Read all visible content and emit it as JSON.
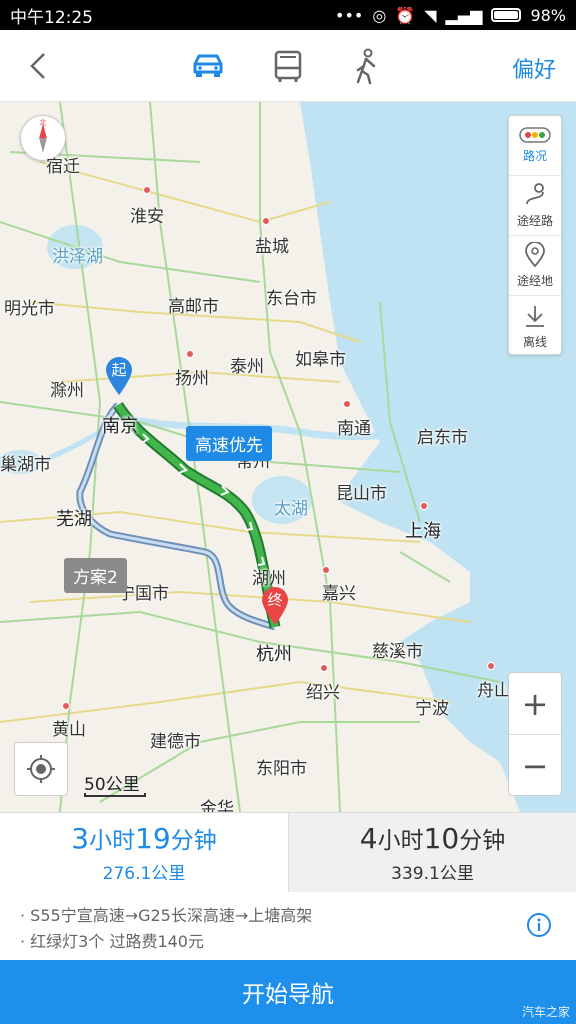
{
  "status_bar": {
    "time": "中午12:25",
    "battery": "98%"
  },
  "header": {
    "preference_label": "偏好"
  },
  "modes": [
    {
      "name": "car",
      "icon": "car-icon",
      "active": true
    },
    {
      "name": "bus",
      "icon": "bus-icon",
      "active": false
    },
    {
      "name": "walk",
      "icon": "walk-icon",
      "active": false
    }
  ],
  "map": {
    "compass_letter": "北",
    "cities": [
      {
        "name": "宿迁"
      },
      {
        "name": "淮安"
      },
      {
        "name": "盐城"
      },
      {
        "name": "洪泽湖"
      },
      {
        "name": "明光市"
      },
      {
        "name": "高邮市"
      },
      {
        "name": "东台市"
      },
      {
        "name": "如皋市"
      },
      {
        "name": "泰州"
      },
      {
        "name": "扬州"
      },
      {
        "name": "滁州"
      },
      {
        "name": "南京"
      },
      {
        "name": "南通"
      },
      {
        "name": "启东市"
      },
      {
        "name": "巢湖市"
      },
      {
        "name": "常州"
      },
      {
        "name": "太湖"
      },
      {
        "name": "昆山市"
      },
      {
        "name": "芜湖"
      },
      {
        "name": "上海"
      },
      {
        "name": "湖州"
      },
      {
        "name": "宁国市"
      },
      {
        "name": "嘉兴"
      },
      {
        "name": "慈溪市"
      },
      {
        "name": "杭州"
      },
      {
        "name": "绍兴"
      },
      {
        "name": "舟山"
      },
      {
        "name": "黄山"
      },
      {
        "name": "宁波"
      },
      {
        "name": "建德市"
      },
      {
        "name": "东阳市"
      },
      {
        "name": "金华"
      }
    ],
    "start_marker": "起",
    "end_marker": "终",
    "main_route_tag": "高速优先",
    "alt_route_tag": "方案2",
    "scale": "50公里"
  },
  "toolbox": [
    {
      "label": "路况",
      "icon": "traffic-light-icon",
      "active": true
    },
    {
      "label": "途经路",
      "icon": "via-road-icon",
      "active": false
    },
    {
      "label": "途经地",
      "icon": "via-place-icon",
      "active": false
    },
    {
      "label": "离线",
      "icon": "download-icon",
      "active": false
    }
  ],
  "zoom": {
    "in": "+",
    "out": "−"
  },
  "plans": [
    {
      "hours": "3",
      "h_unit": "小时",
      "minutes": "19",
      "m_unit": "分钟",
      "distance": "276.1公里",
      "selected": true
    },
    {
      "hours": "4",
      "h_unit": "小时",
      "minutes": "10",
      "m_unit": "分钟",
      "distance": "339.1公里",
      "selected": false
    }
  ],
  "details": {
    "roads": "· S55宁宣高速→G25长深高速→上塘高架",
    "extra": "· 红绿灯3个  过路费140元"
  },
  "start_nav_label": "开始导航",
  "watermark": "汽车之家",
  "colors": {
    "accent": "#1e90ec",
    "route_green": "#3aa844",
    "sea": "#bfe3f2",
    "land": "#f3f1ea"
  }
}
